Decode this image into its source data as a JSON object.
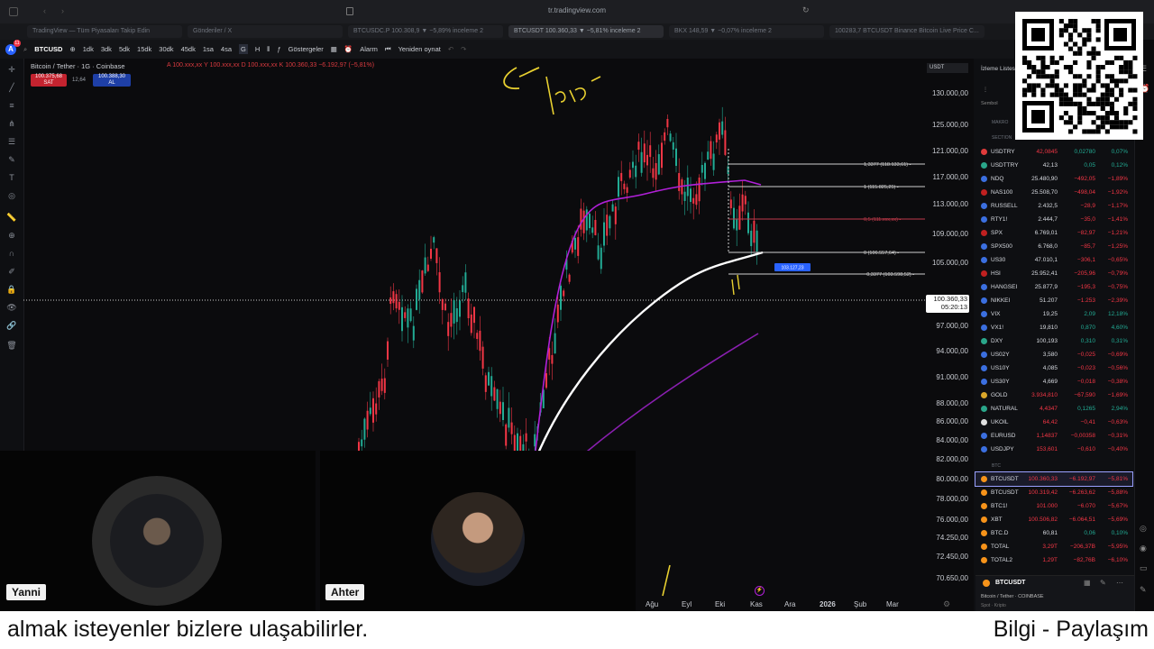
{
  "browser": {
    "url": "tr.tradingview.com",
    "tabs": [
      {
        "label": "TradingView — Tüm Piyasaları Takip Edin"
      },
      {
        "label": "Gönderiler / X"
      },
      {
        "label": "BTCUSDC.P 100.308,9 ▼ −5,89% inceleme 2"
      },
      {
        "label": "BTCUSDT 100.360,33 ▼ −5,81% inceleme 2",
        "active": true
      },
      {
        "label": "BKX 148,59 ▼ −0,07% inceleme 2"
      },
      {
        "label": "100283,7 BTCUSDT Binance Bitcoin Live Price C..."
      }
    ]
  },
  "toolbar": {
    "symbol": "BTCUSD",
    "intervals": [
      "1dk",
      "3dk",
      "5dk",
      "15dk",
      "30dk",
      "45dk",
      "1sa",
      "4sa",
      "G",
      "H"
    ],
    "indicators_label": "Göstergeler",
    "alert_label": "Alarm",
    "replay_label": "Yeniden oynat",
    "notification_count": "11"
  },
  "chart": {
    "title": "Bitcoin / Tether · 1G · Coinbase",
    "ohlc_text": "A 100.xxx,xx Y 100.xxx,xx D 100.xxx,xx K 100.360,33 −6.192,97 (−5,81%)",
    "sell_price": "100.375,68",
    "sell_label": "SAT",
    "spread": "12,64",
    "buy_price": "100.388,30",
    "buy_label": "AL",
    "currency_select": "USDT",
    "current_price": "100.360,33",
    "countdown": "05:20:13",
    "price_ticks": [
      "130.000,00",
      "125.000,00",
      "121.000,00",
      "117.000,00",
      "113.000,00",
      "109.000,00",
      "105.000,00",
      "100.360,33",
      "97.000,00",
      "94.000,00",
      "91.000,00",
      "88.000,00",
      "86.000,00",
      "84.000,00",
      "82.000,00",
      "80.000,00",
      "78.000,00",
      "76.000,00",
      "74.250,00",
      "72.450,00",
      "70.650,00"
    ],
    "time_ticks": [
      "Ağu",
      "Eyl",
      "Eki",
      "Kas",
      "Ara",
      "2026",
      "Şub",
      "Mar"
    ],
    "fib_labels": [
      "1,3377 (118.133,61) ▪",
      "1 (115.825,25) ▪",
      "0,5 (111.xxx,xx) ▪",
      "0 (106.557,64) ▪",
      "−0,3377 (103.598,52) ▪"
    ],
    "position_label": "103.127,23",
    "colors": {
      "up": "#22ab94",
      "down": "#f23645",
      "ma_short": "#b020d8",
      "ma_long": "#8a1fb0",
      "ma_white": "#ffffff",
      "annotation": "#e8d030"
    }
  },
  "watchlist": {
    "title": "İzleme Listesi",
    "col_symbol": "Sembol",
    "section_makro": "MAKRO",
    "section_section": "SECTION",
    "section_btc": "BTC",
    "rows": [
      {
        "sym": "USDTRY",
        "last": "42,0845",
        "chg": "0,02780",
        "pct": "0,07%",
        "dir": "green",
        "color": "#e03b3b"
      },
      {
        "sym": "USDTTRY",
        "last": "42,13",
        "chg": "0,05",
        "pct": "0,12%",
        "dir": "green",
        "color": "#2aa68a"
      },
      {
        "sym": "NDQ",
        "last": "25.480,90",
        "chg": "−492,05",
        "pct": "−1,89%",
        "dir": "red",
        "color": "#3b6fe0"
      },
      {
        "sym": "NAS100",
        "last": "25.508,70",
        "chg": "−498,04",
        "pct": "−1,92%",
        "dir": "red",
        "color": "#c02020"
      },
      {
        "sym": "RUSSELL",
        "last": "2.432,5",
        "chg": "−28,9",
        "pct": "−1,17%",
        "dir": "red",
        "color": "#3b6fe0"
      },
      {
        "sym": "RTY1!",
        "last": "2.444,7",
        "chg": "−35,0",
        "pct": "−1,41%",
        "dir": "red",
        "color": "#3b6fe0"
      },
      {
        "sym": "SPX",
        "last": "6.769,01",
        "chg": "−82,97",
        "pct": "−1,21%",
        "dir": "red",
        "color": "#c02020"
      },
      {
        "sym": "SPX500",
        "last": "6.768,0",
        "chg": "−85,7",
        "pct": "−1,25%",
        "dir": "red",
        "color": "#3b6fe0"
      },
      {
        "sym": "US30",
        "last": "47.010,1",
        "chg": "−306,1",
        "pct": "−0,65%",
        "dir": "red",
        "color": "#3b6fe0"
      },
      {
        "sym": "HSI",
        "last": "25.952,41",
        "chg": "−205,96",
        "pct": "−0,79%",
        "dir": "red",
        "color": "#c02020"
      },
      {
        "sym": "HANGSEI",
        "last": "25.877,9",
        "chg": "−195,3",
        "pct": "−0,75%",
        "dir": "red",
        "color": "#3b6fe0"
      },
      {
        "sym": "NIKKEI",
        "last": "51.207",
        "chg": "−1.253",
        "pct": "−2,39%",
        "dir": "red",
        "color": "#3b6fe0"
      },
      {
        "sym": "VIX",
        "last": "19,25",
        "chg": "2,09",
        "pct": "12,18%",
        "dir": "green",
        "color": "#3b6fe0"
      },
      {
        "sym": "VX1!",
        "last": "19,810",
        "chg": "0,870",
        "pct": "4,60%",
        "dir": "green",
        "color": "#3b6fe0"
      },
      {
        "sym": "DXY",
        "last": "100,193",
        "chg": "0,310",
        "pct": "0,31%",
        "dir": "green",
        "color": "#2aa68a"
      },
      {
        "sym": "US02Y",
        "last": "3,580",
        "chg": "−0,025",
        "pct": "−0,69%",
        "dir": "red",
        "color": "#3b6fe0"
      },
      {
        "sym": "US10Y",
        "last": "4,085",
        "chg": "−0,023",
        "pct": "−0,56%",
        "dir": "red",
        "color": "#3b6fe0"
      },
      {
        "sym": "US30Y",
        "last": "4,669",
        "chg": "−0,018",
        "pct": "−0,38%",
        "dir": "red",
        "color": "#3b6fe0"
      },
      {
        "sym": "GOLD",
        "last": "3.934,810",
        "chg": "−67,590",
        "pct": "−1,69%",
        "dir": "red",
        "color": "#d9a62a"
      },
      {
        "sym": "NATURAL",
        "last": "4,4347",
        "chg": "0,1265",
        "pct": "2,94%",
        "dir": "green",
        "color": "#2aa68a"
      },
      {
        "sym": "UKOIL",
        "last": "64,42",
        "chg": "−0,41",
        "pct": "−0,63%",
        "dir": "red",
        "color": "#e0e0e0"
      },
      {
        "sym": "EURUSD",
        "last": "1,14837",
        "chg": "−0,00358",
        "pct": "−0,31%",
        "dir": "red",
        "color": "#3b6fe0"
      },
      {
        "sym": "USDJPY",
        "last": "153,601",
        "chg": "−0,610",
        "pct": "−0,40%",
        "dir": "red",
        "color": "#3b6fe0"
      },
      {
        "sym": "BTCUSDT",
        "last": "100.360,33",
        "chg": "−6.192,97",
        "pct": "−5,81%",
        "dir": "red",
        "color": "#f7931a"
      },
      {
        "sym": "BTCUSDT",
        "last": "100.319,42",
        "chg": "−6.263,62",
        "pct": "−5,88%",
        "dir": "red",
        "color": "#f7931a"
      },
      {
        "sym": "BTC1!",
        "last": "101.000",
        "chg": "−6.070",
        "pct": "−5,67%",
        "dir": "red",
        "color": "#f7931a"
      },
      {
        "sym": "XBT",
        "last": "100.506,82",
        "chg": "−6.064,51",
        "pct": "−5,69%",
        "dir": "red",
        "color": "#f7931a"
      },
      {
        "sym": "BTC.D",
        "last": "60,81",
        "chg": "0,06",
        "pct": "0,10%",
        "dir": "green",
        "color": "#f7931a"
      },
      {
        "sym": "TOTAL",
        "last": "3,29T",
        "chg": "−206,37B",
        "pct": "−5,95%",
        "dir": "red",
        "color": "#f7931a"
      },
      {
        "sym": "TOTAL2",
        "last": "1,29T",
        "chg": "−82,76B",
        "pct": "−6,10%",
        "dir": "red",
        "color": "#f7931a"
      }
    ],
    "bottom_symbol": "BTCUSDT",
    "bottom_desc": "Bitcoin / Tether · COINBASE",
    "bottom_sub": "Spot · Kripto"
  },
  "webcams": {
    "left_name": "Yanni",
    "right_name": "Ahter"
  },
  "caption": {
    "left": "almak isteyenler bizlere ulaşabilirler.",
    "right": "Bilgi - Paylaşım"
  }
}
